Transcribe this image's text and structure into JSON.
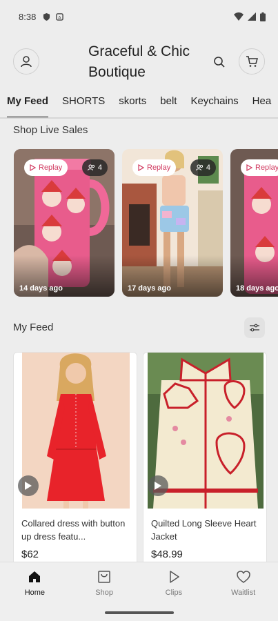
{
  "status_bar": {
    "time": "8:38"
  },
  "header": {
    "shop_title": "Graceful & Chic Boutique"
  },
  "tabs": [
    {
      "label": "My Feed",
      "active": true
    },
    {
      "label": "SHORTS"
    },
    {
      "label": "skorts"
    },
    {
      "label": "belt"
    },
    {
      "label": "Keychains"
    },
    {
      "label": "Hea"
    }
  ],
  "live_section": {
    "title": "Shop Live Sales",
    "cards": [
      {
        "replay_label": "Replay",
        "viewers": "4",
        "ago": "14 days ago"
      },
      {
        "replay_label": "Replay",
        "viewers": "4",
        "ago": "17 days ago"
      },
      {
        "replay_label": "Replay",
        "viewers": "",
        "ago": "18 days ago"
      }
    ]
  },
  "feed_section": {
    "title": "My Feed",
    "items": [
      {
        "title": "Collared dress with button up dress featu...",
        "price": "$62"
      },
      {
        "title": "Quilted Long Sleeve Heart Jacket",
        "price": "$48.99"
      }
    ]
  },
  "bottom_nav": [
    {
      "label": "Home",
      "icon": "home-icon",
      "active": true
    },
    {
      "label": "Shop",
      "icon": "shop-icon"
    },
    {
      "label": "Clips",
      "icon": "play-icon"
    },
    {
      "label": "Waitlist",
      "icon": "heart-icon"
    }
  ],
  "colors": {
    "accent": "#d0365d",
    "background": "#ededed"
  }
}
